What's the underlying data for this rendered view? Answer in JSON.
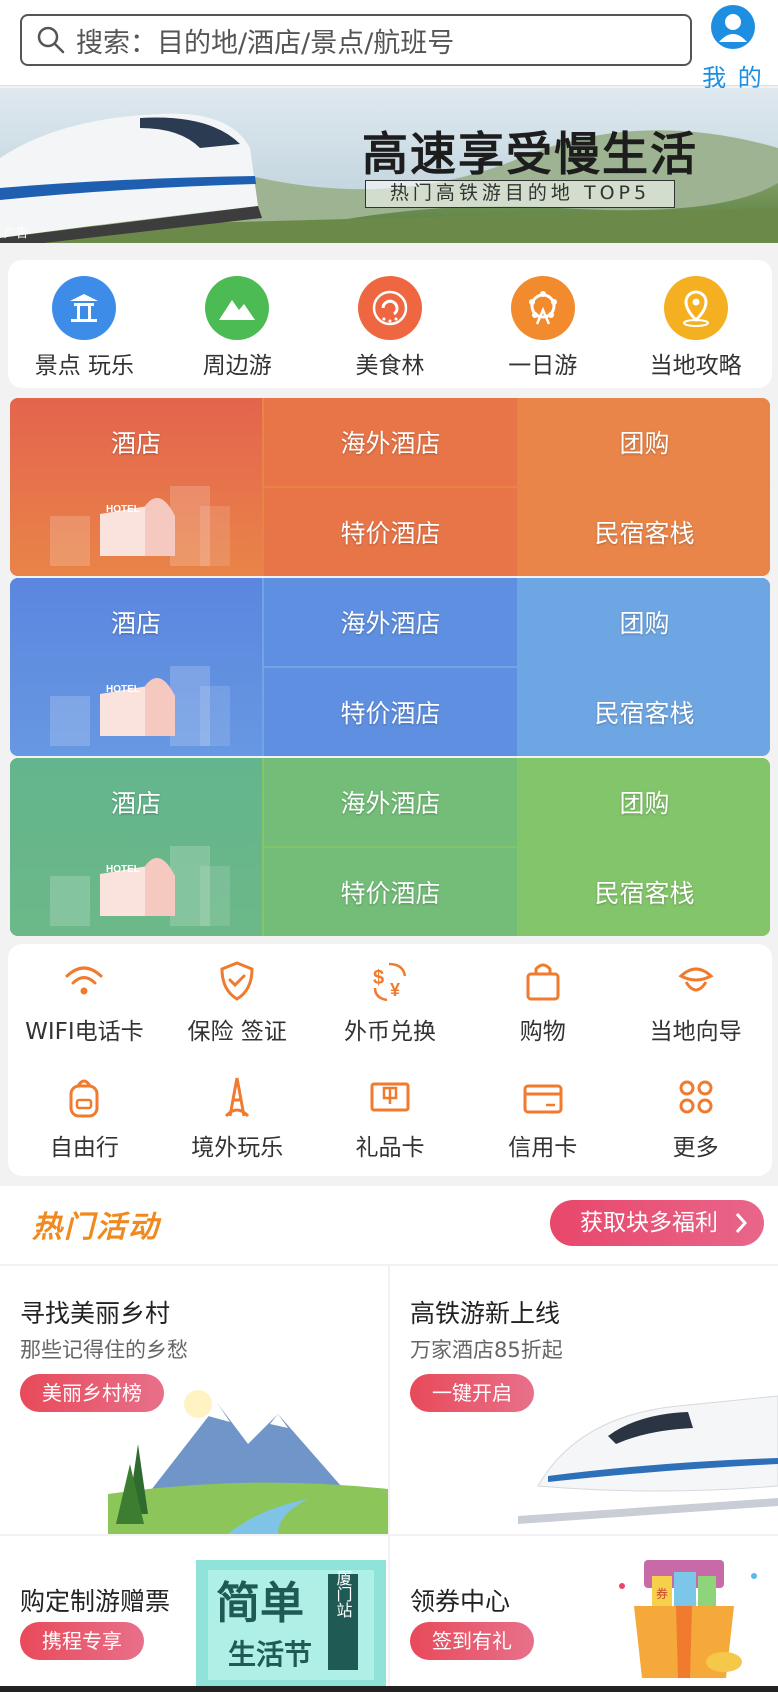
{
  "search": {
    "placeholder": "搜索：目的地/酒店/景点/航班号"
  },
  "me": {
    "label": "我 的"
  },
  "banner": {
    "title": "高速享受慢生活",
    "subtitle": "热门高铁游目的地 TOP5",
    "ad_tag": "广告"
  },
  "categories": [
    {
      "label": "景点 玩乐",
      "icon": "pavilion-icon",
      "color": "#3d8de8"
    },
    {
      "label": "周边游",
      "icon": "mountain-icon",
      "color": "#4dbb53"
    },
    {
      "label": "美食林",
      "icon": "food-icon",
      "color": "#ef6740"
    },
    {
      "label": "一日游",
      "icon": "ferris-wheel-icon",
      "color": "#f28a2e"
    },
    {
      "label": "当地攻略",
      "icon": "location-pin-icon",
      "color": "#f5b021"
    }
  ],
  "hotel_grids": [
    {
      "main": "酒店",
      "cells": [
        "海外酒店",
        "团购",
        "特价酒店",
        "民宿客栈"
      ],
      "hotel_sign": "HOTEL",
      "colors": {
        "main": "#e4644e",
        "accent": "#e98448"
      }
    },
    {
      "main": "酒店",
      "cells": [
        "海外酒店",
        "团购",
        "特价酒店",
        "民宿客栈"
      ],
      "hotel_sign": "HOTEL",
      "colors": {
        "main": "#5b86df",
        "accent": "#6ea6e3"
      }
    },
    {
      "main": "酒店",
      "cells": [
        "海外酒店",
        "团购",
        "特价酒店",
        "民宿客栈"
      ],
      "hotel_sign": "HOTEL",
      "colors": {
        "main": "#63b58d",
        "accent": "#83c56a"
      }
    }
  ],
  "services": [
    {
      "label": "WIFI电话卡",
      "icon": "wifi-icon"
    },
    {
      "label": "保险 签证",
      "icon": "shield-icon"
    },
    {
      "label": "外币兑换",
      "icon": "currency-exchange-icon"
    },
    {
      "label": "购物",
      "icon": "shopping-bag-icon"
    },
    {
      "label": "当地向导",
      "icon": "guide-hat-icon"
    },
    {
      "label": "自由行",
      "icon": "backpack-icon"
    },
    {
      "label": "境外玩乐",
      "icon": "eiffel-tower-icon"
    },
    {
      "label": "礼品卡",
      "icon": "gift-card-icon"
    },
    {
      "label": "信用卡",
      "icon": "credit-card-icon"
    },
    {
      "label": "更多",
      "icon": "more-grid-icon"
    }
  ],
  "hot": {
    "title": "热门活动",
    "button": "获取块多福利"
  },
  "tiles": [
    {
      "title": "寻找美丽乡村",
      "subtitle": "那些记得住的乡愁",
      "pill": "美丽乡村榜"
    },
    {
      "title": "高铁游新上线",
      "subtitle": "万家酒店85折起",
      "pill": "一键开启"
    },
    {
      "title": "购定制游赠票",
      "pill": "携程专享",
      "poster_big": "简单",
      "poster_sub": "生活节",
      "poster_tag": "厦门站"
    },
    {
      "title": "领券中心",
      "pill": "签到有礼",
      "coupon_char": "券"
    }
  ],
  "theme": {
    "primary": "#1e8fe0",
    "orange": "#f07a2e",
    "pink": "#e8476b"
  }
}
